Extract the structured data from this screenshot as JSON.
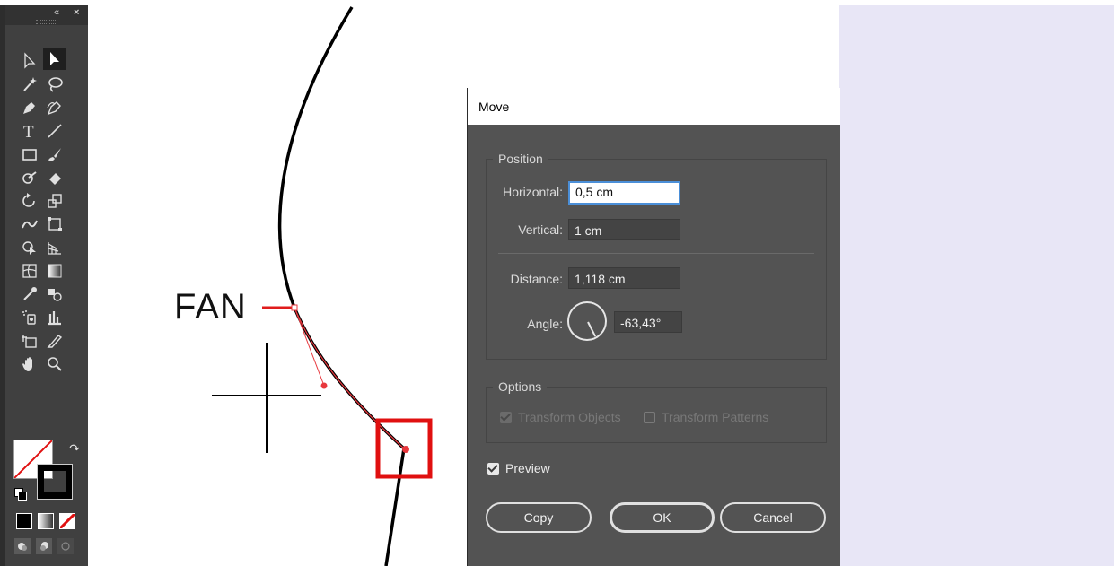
{
  "toolbar": {
    "collapse_glyph": "«",
    "close_glyph": "×",
    "tools": [
      {
        "name": "direct-selection-tool",
        "icon": "direct-selection-arrow-icon"
      },
      {
        "name": "selection-tool",
        "icon": "selection-arrow-icon",
        "selected": true
      },
      {
        "name": "magic-wand-tool",
        "icon": "magic-wand-icon"
      },
      {
        "name": "lasso-tool",
        "icon": "lasso-icon"
      },
      {
        "name": "pen-tool",
        "icon": "pen-icon"
      },
      {
        "name": "curvature-tool",
        "icon": "curvature-pen-icon"
      },
      {
        "name": "type-tool",
        "icon": "type-icon"
      },
      {
        "name": "line-segment-tool",
        "icon": "line-segment-icon"
      },
      {
        "name": "rectangle-tool",
        "icon": "rectangle-icon"
      },
      {
        "name": "paintbrush-tool",
        "icon": "paintbrush-icon"
      },
      {
        "name": "shaper-tool",
        "icon": "shaper-icon"
      },
      {
        "name": "eraser-tool",
        "icon": "eraser-icon"
      },
      {
        "name": "rotate-tool",
        "icon": "rotate-icon"
      },
      {
        "name": "scale-tool",
        "icon": "scale-icon"
      },
      {
        "name": "width-tool",
        "icon": "width-icon"
      },
      {
        "name": "free-transform-tool",
        "icon": "free-transform-icon"
      },
      {
        "name": "shape-builder-tool",
        "icon": "shape-builder-icon"
      },
      {
        "name": "perspective-grid-tool",
        "icon": "perspective-grid-icon"
      },
      {
        "name": "mesh-tool",
        "icon": "mesh-icon"
      },
      {
        "name": "gradient-tool",
        "icon": "gradient-icon"
      },
      {
        "name": "eyedropper-tool",
        "icon": "eyedropper-icon"
      },
      {
        "name": "blend-tool",
        "icon": "blend-icon"
      },
      {
        "name": "symbol-sprayer-tool",
        "icon": "symbol-sprayer-icon"
      },
      {
        "name": "column-graph-tool",
        "icon": "column-graph-icon"
      },
      {
        "name": "artboard-tool",
        "icon": "artboard-icon"
      },
      {
        "name": "slice-tool",
        "icon": "slice-icon"
      },
      {
        "name": "hand-tool",
        "icon": "hand-icon"
      },
      {
        "name": "zoom-tool",
        "icon": "zoom-magnifier-icon"
      }
    ]
  },
  "canvas": {
    "fan_label": "FAN",
    "colors": {
      "path": "#000000",
      "anchor": "#e8373d",
      "selection_box": "#e01010"
    }
  },
  "dialog": {
    "title": "Move",
    "position_legend": "Position",
    "horizontal_label": "Horizontal:",
    "horizontal_value": "0,5 cm",
    "vertical_label": "Vertical:",
    "vertical_value": "1 cm",
    "distance_label": "Distance:",
    "distance_value": "1,118 cm",
    "angle_label": "Angle:",
    "angle_value": "-63,43°",
    "options_legend": "Options",
    "transform_objects_label": "Transform Objects",
    "transform_objects_checked": true,
    "transform_patterns_label": "Transform Patterns",
    "transform_patterns_checked": false,
    "preview_label": "Preview",
    "preview_checked": true,
    "copy_label": "Copy",
    "ok_label": "OK",
    "cancel_label": "Cancel"
  }
}
